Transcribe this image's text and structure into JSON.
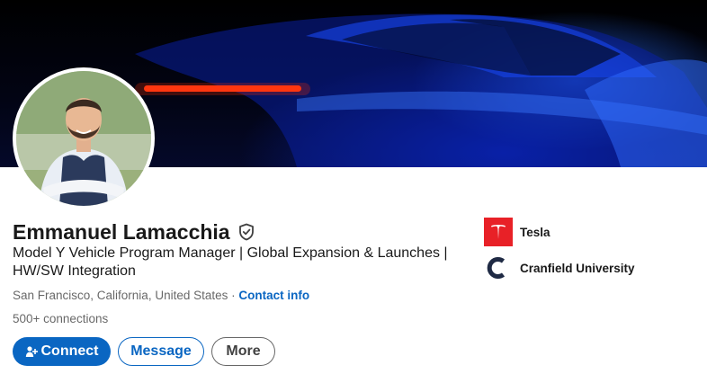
{
  "profile": {
    "name": "Emmanuel Lamacchia",
    "headline": "Model Y Vehicle Program Manager | Global Expansion & Launches | HW/SW Integration",
    "location": "San Francisco, California, United States",
    "separator": " · ",
    "contact_info_label": "Contact info",
    "connections_label": "500+ connections"
  },
  "actions": {
    "connect_label": "Connect",
    "message_label": "Message",
    "more_label": "More"
  },
  "orgs": [
    {
      "name": "Tesla",
      "logo": "tesla-logo"
    },
    {
      "name": "Cranfield University",
      "logo": "cranfield-logo"
    }
  ],
  "icons": {
    "verified": "verified-shield-icon",
    "connect": "add-user-icon"
  },
  "colors": {
    "brand_blue": "#0a66c2",
    "tesla_red": "#e82127",
    "cranfield_navy": "#1f2a44"
  }
}
